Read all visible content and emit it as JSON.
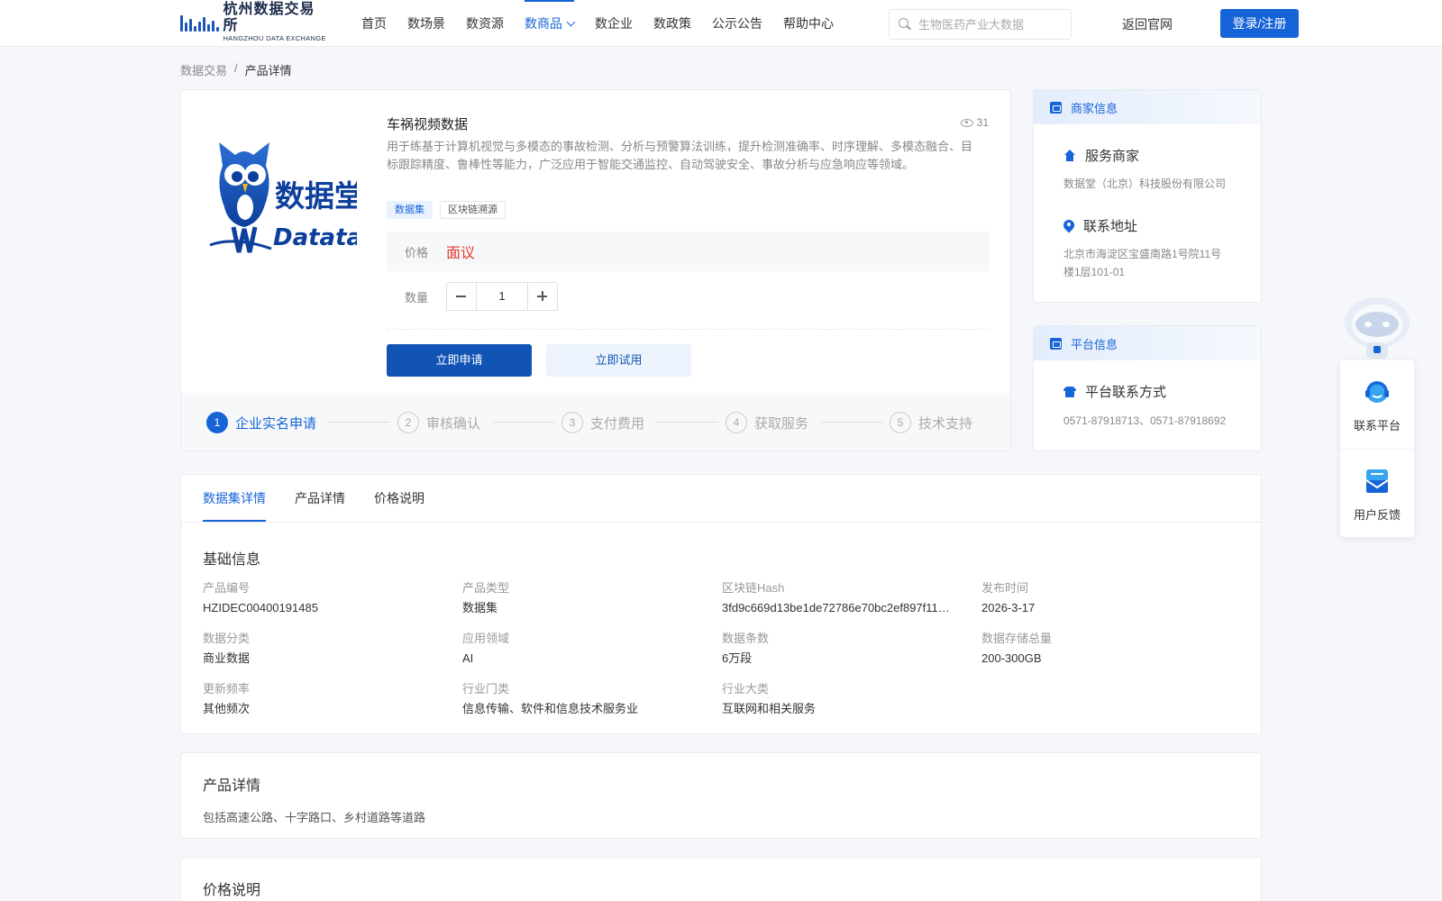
{
  "header": {
    "logo_cn": "杭州数据交易所",
    "logo_en": "HANGZHOU DATA EXCHANGE",
    "nav": [
      "首页",
      "数场景",
      "数资源",
      "数商品",
      "数企业",
      "数政策",
      "公示公告",
      "帮助中心"
    ],
    "active_nav": "数商品",
    "search_placeholder": "生物医药产业大数据",
    "back_link": "返回官网",
    "login": "登录/注册"
  },
  "breadcrumb": {
    "first": "数据交易",
    "sep": "/",
    "current": "产品详情"
  },
  "product": {
    "logo_text": "数据堂",
    "logo_en": "Datatang",
    "title": "车祸视频数据",
    "views": "31",
    "description": "用于练基于计算机视觉与多模态的事故检测、分析与预警算法训练，提升检测准确率、时序理解、多模态融合、目标跟踪精度、鲁棒性等能力，广泛应用于智能交通监控、自动驾驶安全、事故分析与应急响应等领域。",
    "tags": [
      "数据集",
      "区块链溯源"
    ],
    "price_label": "价格",
    "price_value": "面议",
    "qty_label": "数量",
    "qty_value": "1",
    "apply_button": "立即申请",
    "trial_button": "立即试用",
    "steps": [
      {
        "num": "1",
        "label": "企业实名申请"
      },
      {
        "num": "2",
        "label": "审核确认"
      },
      {
        "num": "3",
        "label": "支付费用"
      },
      {
        "num": "4",
        "label": "获取服务"
      },
      {
        "num": "5",
        "label": "技术支持"
      }
    ]
  },
  "merchant": {
    "header": "商家信息",
    "service_title": "服务商家",
    "service_name": "数据堂（北京）科技股份有限公司",
    "address_title": "联系地址",
    "address": "北京市海淀区宝盛南路1号院11号楼1层101-01"
  },
  "platform": {
    "header": "平台信息",
    "contact_title": "平台联系方式",
    "phones": "0571-87918713、0571-87918692"
  },
  "tabs": [
    "数据集详情",
    "产品详情",
    "价格说明"
  ],
  "basic_info": {
    "title": "基础信息",
    "fields": [
      {
        "label": "产品编号",
        "value": "HZIDEC00400191485"
      },
      {
        "label": "产品类型",
        "value": "数据集"
      },
      {
        "label": "区块链Hash",
        "value": "3fd9c669d13be1de72786e70bc2ef897f11…"
      },
      {
        "label": "发布时间",
        "value": "2026-3-17"
      },
      {
        "label": "数据分类",
        "value": "商业数据"
      },
      {
        "label": "应用领域",
        "value": "AI"
      },
      {
        "label": "数据条数",
        "value": "6万段"
      },
      {
        "label": "数据存储总量",
        "value": "200-300GB"
      },
      {
        "label": "更新频率",
        "value": "其他频次"
      },
      {
        "label": "行业门类",
        "value": "信息传输、软件和信息技术服务业"
      },
      {
        "label": "行业大类",
        "value": "互联网和相关服务"
      }
    ]
  },
  "detail": {
    "title": "产品详情",
    "text": "包括高速公路、十字路口、乡村道路等道路"
  },
  "price_section": {
    "title": "价格说明"
  },
  "float_widget": {
    "contact": "联系平台",
    "feedback": "用户反馈"
  },
  "colors": {
    "accent": "#1764d8",
    "price": "#e33b2e"
  }
}
